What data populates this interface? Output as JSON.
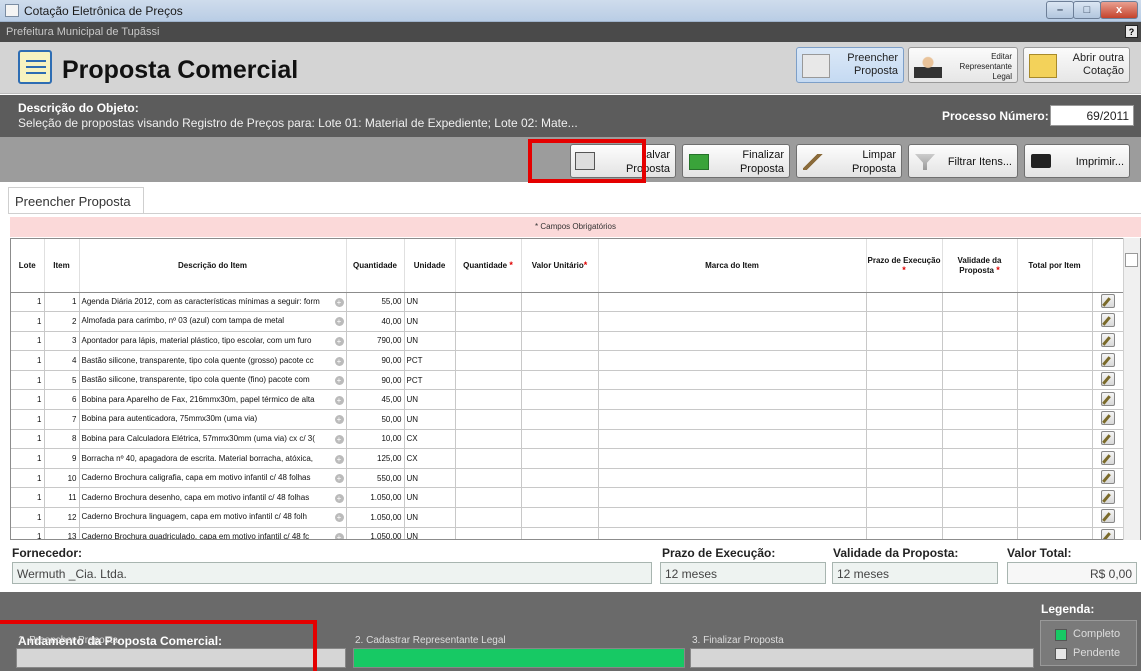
{
  "window": {
    "title": "Cotação Eletrônica de Preços",
    "subtitle": "Prefeitura Municipal de Tupãssi",
    "help_label": "?"
  },
  "header": {
    "title": "Proposta Comercial",
    "btn_preencher": "Preencher Proposta",
    "btn_editar": "Editar Representante Legal",
    "btn_abrir": "Abrir outra Cotação"
  },
  "object": {
    "label": "Descrição do Objeto:",
    "text": "Seleção de propostas visando Registro de Preços para: Lote 01: Material de Expediente; Lote 02: Mate...",
    "process_label": "Processo Número:",
    "process_value": "69/2011"
  },
  "toolbar": {
    "salvar": "alvar",
    "salvar2": "Proposta",
    "finalizar": "Finalizar Proposta",
    "limpar": "Limpar Proposta",
    "filtrar": "Filtrar Itens...",
    "imprimir": "Imprimir..."
  },
  "tab": "Preencher Proposta",
  "required_note": "* Campos Obrigatórios",
  "grid": {
    "columns": [
      "Lote",
      "Item",
      "Descrição do Item",
      "Quantidade",
      "Unidade",
      "Quantidade",
      "Valor Unitário",
      "Marca do Item",
      "Prazo de Execução",
      "Validade da Proposta",
      "Total por Item"
    ],
    "rows": [
      {
        "lote": "1",
        "item": "1",
        "desc": "Agenda Diária 2012, com as características mínimas a seguir: form",
        "qtd": "55,00",
        "un": "UN"
      },
      {
        "lote": "1",
        "item": "2",
        "desc": "Almofada para carimbo, nº 03 (azul) com tampa de metal",
        "qtd": "40,00",
        "un": "UN"
      },
      {
        "lote": "1",
        "item": "3",
        "desc": "Apontador para lápis, material plástico, tipo escolar, com um furo",
        "qtd": "790,00",
        "un": "UN"
      },
      {
        "lote": "1",
        "item": "4",
        "desc": "Bastão silicone, transparente, tipo cola quente (grosso) pacote cc",
        "qtd": "90,00",
        "un": "PCT"
      },
      {
        "lote": "1",
        "item": "5",
        "desc": "Bastão silicone, transparente, tipo cola quente (fino) pacote com",
        "qtd": "90,00",
        "un": "PCT"
      },
      {
        "lote": "1",
        "item": "6",
        "desc": "Bobina para Aparelho de Fax, 216mmx30m, papel térmico de alta",
        "qtd": "45,00",
        "un": "UN"
      },
      {
        "lote": "1",
        "item": "7",
        "desc": "Bobina para autenticadora, 75mmx30m (uma via)",
        "qtd": "50,00",
        "un": "UN"
      },
      {
        "lote": "1",
        "item": "8",
        "desc": "Bobina para Calculadora Elétrica, 57mmx30mm (uma via) cx c/ 3(",
        "qtd": "10,00",
        "un": "CX"
      },
      {
        "lote": "1",
        "item": "9",
        "desc": "Borracha nº 40, apagadora de escrita. Material borracha, atóxica,",
        "qtd": "125,00",
        "un": "CX"
      },
      {
        "lote": "1",
        "item": "10",
        "desc": "Caderno Brochura caligrafia, capa em motivo infantil c/ 48 folhas",
        "qtd": "550,00",
        "un": "UN"
      },
      {
        "lote": "1",
        "item": "11",
        "desc": "Caderno Brochura desenho, capa em motivo infantil c/ 48 folhas",
        "qtd": "1.050,00",
        "un": "UN"
      },
      {
        "lote": "1",
        "item": "12",
        "desc": "Caderno Brochura linguagem, capa em motivo infantil c/ 48 folh",
        "qtd": "1.050,00",
        "un": "UN"
      },
      {
        "lote": "1",
        "item": "13",
        "desc": "Caderno Brochura quadriculado, capa em motivo infantil c/ 48 fc",
        "qtd": "1.050,00",
        "un": "UN"
      }
    ]
  },
  "footer": {
    "fornecedor_label": "Fornecedor:",
    "fornecedor_value": "Wermuth _Cia. Ltda.",
    "prazo_label": "Prazo de Execução:",
    "prazo_value": "12 meses",
    "validade_label": "Validade da Proposta:",
    "validade_value": "12 meses",
    "total_label": "Valor Total:",
    "total_value": "R$ 0,00"
  },
  "progress": {
    "label": "Andamento da Proposta Comercial:",
    "step1": "1. Preencher Proposta",
    "step2": "2. Cadastrar Representante Legal",
    "step3": "3. Finalizar Proposta",
    "legend_title": "Legenda:",
    "legend_complete": "Completo",
    "legend_pending": "Pendente",
    "color_complete": "#17c964",
    "color_pending": "#d6d6d6"
  }
}
